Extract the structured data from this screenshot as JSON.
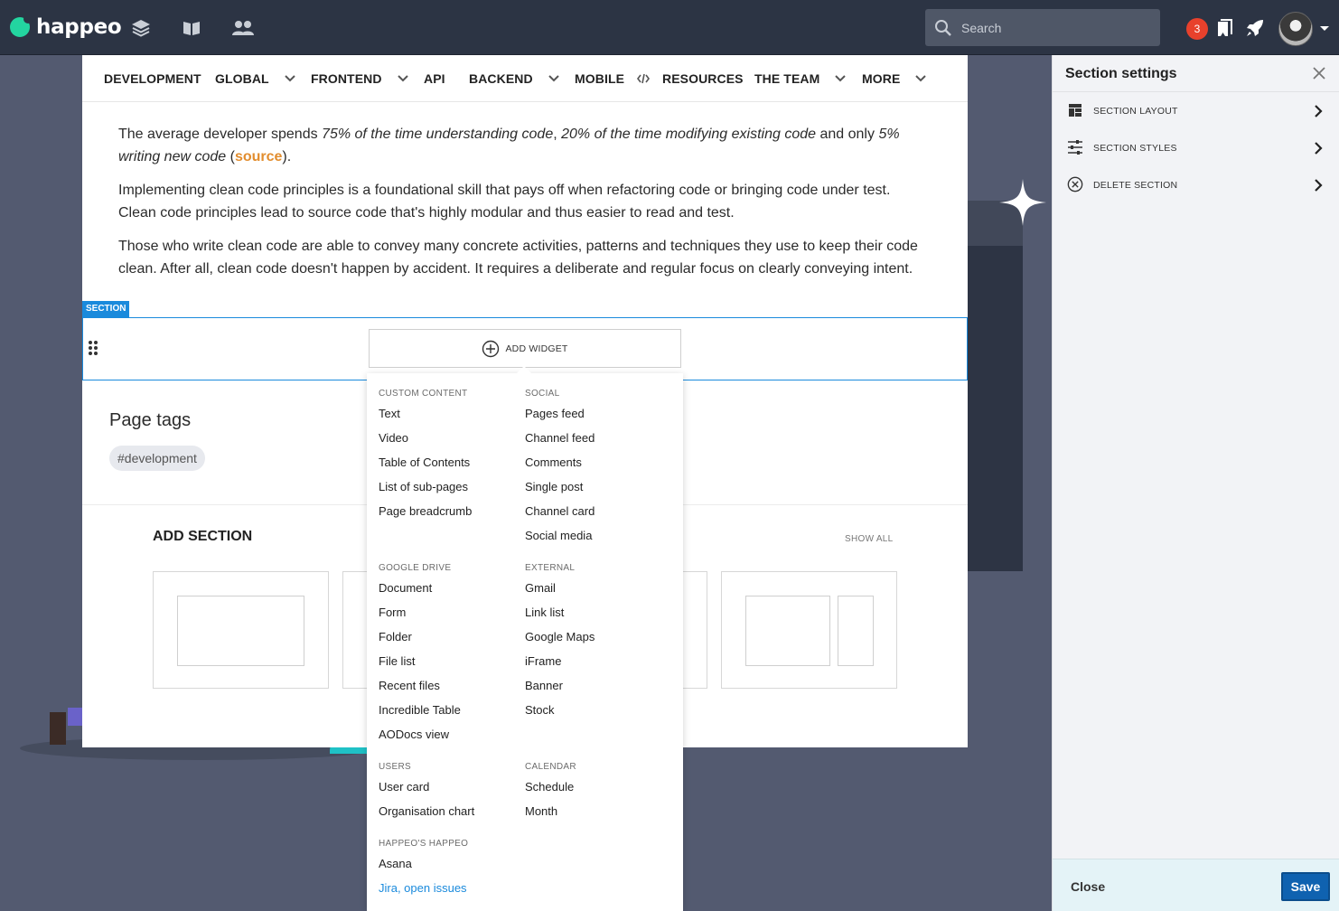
{
  "app": {
    "name": "happeo"
  },
  "search": {
    "placeholder": "Search"
  },
  "notifications": {
    "count": "3"
  },
  "nav": {
    "items": [
      {
        "label": "DEVELOPMENT",
        "has_dropdown": false
      },
      {
        "label": "GLOBAL",
        "has_dropdown": true
      },
      {
        "label": "FRONTEND",
        "has_dropdown": true
      },
      {
        "label": "API",
        "has_dropdown": false
      },
      {
        "label": "BACKEND",
        "has_dropdown": true
      },
      {
        "label": "MOBILE",
        "has_dropdown": false
      },
      {
        "label": "RESOURCES",
        "has_dropdown": false
      },
      {
        "label": "THE TEAM",
        "has_dropdown": true
      },
      {
        "label": "MORE",
        "has_dropdown": true
      }
    ]
  },
  "content": {
    "p1_a": "The average developer spends ",
    "p1_b": "75% of the time understanding code",
    "p1_c": ", ",
    "p1_d": "20% of the time modifying existing code",
    "p1_e": " and only ",
    "p1_f": "5% writing new code",
    "p1_g": " (",
    "p1_link": "source",
    "p1_h": ").",
    "p2": "Implementing clean code principles is a foundational skill that pays off when refactoring code or bringing code under test. Clean code principles lead to source code that's highly modular and thus easier to read and test.",
    "p3": "Those who write clean code are able to convey many concrete activities, patterns and techniques they use to keep their code clean. After all, clean code doesn't happen by accident. It requires a deliberate and regular focus on clearly conveying intent."
  },
  "section": {
    "tag": "SECTION",
    "add_widget": "ADD WIDGET"
  },
  "page_tags": {
    "title": "Page tags",
    "tags": [
      "#development"
    ]
  },
  "add_section": {
    "title": "ADD SECTION",
    "show_all": "SHOW ALL"
  },
  "widget_menu": {
    "custom_content": {
      "heading": "CUSTOM CONTENT",
      "items": [
        "Text",
        "Video",
        "Table of Contents",
        "List of sub-pages",
        "Page breadcrumb"
      ]
    },
    "social": {
      "heading": "SOCIAL",
      "items": [
        "Pages feed",
        "Channel feed",
        "Comments",
        "Single post",
        "Channel card",
        "Social media"
      ]
    },
    "google_drive": {
      "heading": "GOOGLE DRIVE",
      "items": [
        "Document",
        "Form",
        "Folder",
        "File list",
        "Recent files",
        "Incredible Table",
        "AODocs view"
      ]
    },
    "external": {
      "heading": "EXTERNAL",
      "items": [
        "Gmail",
        "Link list",
        "Google Maps",
        "iFrame",
        "Banner",
        "Stock"
      ]
    },
    "users": {
      "heading": "USERS",
      "items": [
        "User card",
        "Organisation chart"
      ]
    },
    "calendar": {
      "heading": "CALENDAR",
      "items": [
        "Schedule",
        "Month"
      ]
    },
    "happeos_happeo": {
      "heading": "HAPPEO'S HAPPEO",
      "items": [
        "Asana",
        "Jira, open issues"
      ]
    }
  },
  "panel": {
    "title": "Section settings",
    "rows": [
      {
        "label": "SECTION LAYOUT",
        "icon": "layout-icon"
      },
      {
        "label": "SECTION STYLES",
        "icon": "sliders-icon"
      },
      {
        "label": "DELETE SECTION",
        "icon": "delete-circle-icon"
      }
    ],
    "close_label": "Close",
    "save_label": "Save"
  },
  "colors": {
    "brand": "#23d5a0",
    "accent": "#1a8adc",
    "topbar": "#2c3444",
    "save": "#0f62b0",
    "link": "#e28d2e"
  }
}
